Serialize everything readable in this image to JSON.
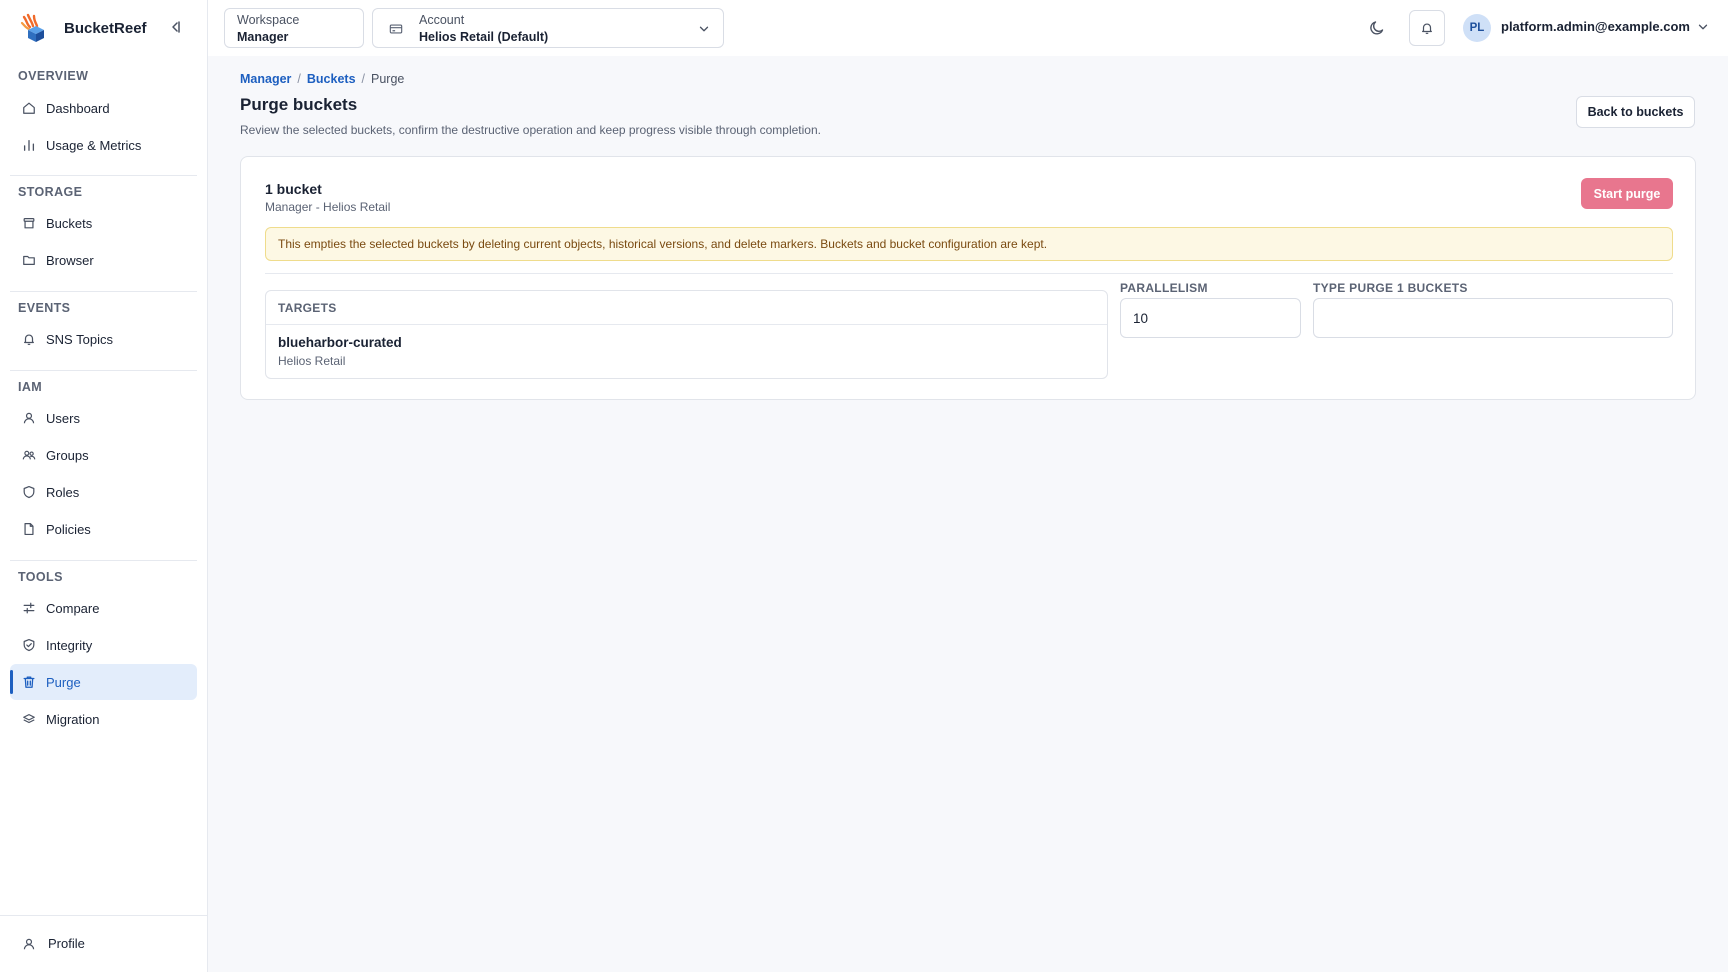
{
  "brand": {
    "name": "BucketReef"
  },
  "sidebar": {
    "sections": [
      {
        "title": "OVERVIEW",
        "items": [
          {
            "label": "Dashboard",
            "icon": "home-icon"
          },
          {
            "label": "Usage & Metrics",
            "icon": "bar-chart-icon"
          }
        ]
      },
      {
        "title": "STORAGE",
        "items": [
          {
            "label": "Buckets",
            "icon": "bucket-icon"
          },
          {
            "label": "Browser",
            "icon": "folder-icon"
          }
        ]
      },
      {
        "title": "EVENTS",
        "items": [
          {
            "label": "SNS Topics",
            "icon": "bell-icon"
          }
        ]
      },
      {
        "title": "IAM",
        "items": [
          {
            "label": "Users",
            "icon": "user-icon"
          },
          {
            "label": "Groups",
            "icon": "users-icon"
          },
          {
            "label": "Roles",
            "icon": "shield-icon"
          },
          {
            "label": "Policies",
            "icon": "file-icon"
          }
        ]
      },
      {
        "title": "TOOLS",
        "items": [
          {
            "label": "Compare",
            "icon": "compare-icon"
          },
          {
            "label": "Integrity",
            "icon": "shield-check-icon"
          },
          {
            "label": "Purge",
            "icon": "trash-icon",
            "active": true
          },
          {
            "label": "Migration",
            "icon": "migration-icon"
          }
        ]
      }
    ],
    "footer": {
      "profile_label": "Profile"
    }
  },
  "topbar": {
    "workspace": {
      "label": "Workspace",
      "value": "Manager"
    },
    "account": {
      "label": "Account",
      "value": "Helios Retail (Default)"
    },
    "user": {
      "initials": "PL",
      "email": "platform.admin@example.com"
    }
  },
  "breadcrumb": {
    "items": [
      "Manager",
      "Buckets"
    ],
    "current": "Purge",
    "separator": "/"
  },
  "page": {
    "title": "Purge buckets",
    "subtitle": "Review the selected buckets, confirm the destructive operation and keep progress visible through completion.",
    "back_label": "Back to buckets"
  },
  "card": {
    "title": "1 bucket",
    "subtitle": "Manager - Helios Retail",
    "start_label": "Start purge",
    "warning": "This empties the selected buckets by deleting current objects, historical versions, and delete markers. Buckets and bucket configuration are kept.",
    "targets_header": "TARGETS",
    "targets": [
      {
        "name": "blueharbor-curated",
        "account": "Helios Retail"
      }
    ],
    "parallelism": {
      "label": "PARALLELISM",
      "value": "10"
    },
    "confirm": {
      "label": "TYPE PURGE 1 BUCKETS",
      "value": ""
    }
  },
  "colors": {
    "accent": "#1d5fc0",
    "danger_button": "#e8768e",
    "warning_bg": "#fdf8e4",
    "active_nav_bg": "#e3edfb"
  }
}
